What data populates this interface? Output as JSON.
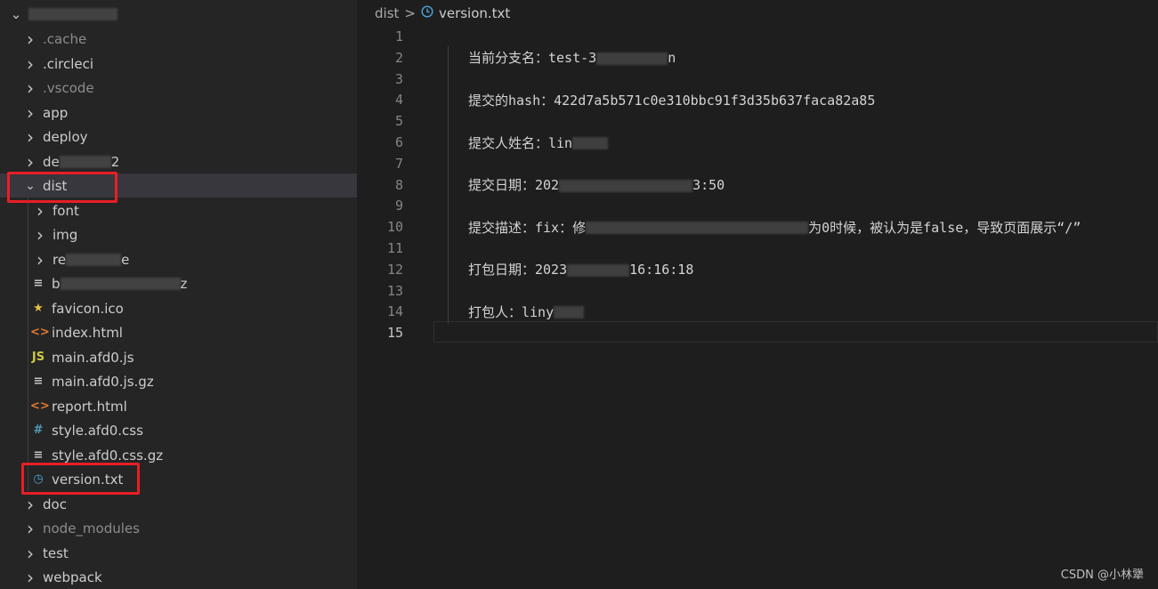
{
  "explorer": {
    "root_label": "",
    "items": [
      {
        "label": ".cache",
        "kind": "folder",
        "expanded": false,
        "dim": true,
        "icon": "chevron-right-icon"
      },
      {
        "label": ".circleci",
        "kind": "folder",
        "expanded": false,
        "dim": false,
        "icon": "chevron-right-icon"
      },
      {
        "label": ".vscode",
        "kind": "folder",
        "expanded": false,
        "dim": true,
        "icon": "chevron-right-icon"
      },
      {
        "label": "app",
        "kind": "folder",
        "expanded": false,
        "dim": false,
        "icon": "chevron-right-icon"
      },
      {
        "label": "deploy",
        "kind": "folder",
        "expanded": false,
        "dim": false,
        "icon": "chevron-right-icon"
      },
      {
        "label": "de",
        "kind": "folder",
        "expanded": false,
        "dim": false,
        "icon": "chevron-right-icon"
      },
      {
        "label": "dist",
        "kind": "folder",
        "expanded": true,
        "dim": false,
        "icon": "chevron-down-icon"
      },
      {
        "label": "font",
        "kind": "folder",
        "expanded": false,
        "dim": false,
        "icon": "chevron-right-icon"
      },
      {
        "label": "img",
        "kind": "folder",
        "expanded": false,
        "dim": false,
        "icon": "chevron-right-icon"
      },
      {
        "label": "re",
        "kind": "folder",
        "expanded": false,
        "dim": false,
        "icon": "chevron-right-icon"
      },
      {
        "label": "b",
        "kind": "file",
        "dim": false,
        "icon": "text-file-icon"
      },
      {
        "label": "favicon.ico",
        "kind": "file",
        "dim": false,
        "icon": "star-icon"
      },
      {
        "label": "index.html",
        "kind": "file",
        "dim": false,
        "icon": "html-icon"
      },
      {
        "label": "main.afd0.js",
        "kind": "file",
        "dim": false,
        "icon": "js-icon"
      },
      {
        "label": "main.afd0.js.gz",
        "kind": "file",
        "dim": false,
        "icon": "text-file-icon"
      },
      {
        "label": "report.html",
        "kind": "file",
        "dim": false,
        "icon": "html-icon"
      },
      {
        "label": "style.afd0.css",
        "kind": "file",
        "dim": false,
        "icon": "css-icon"
      },
      {
        "label": "style.afd0.css.gz",
        "kind": "file",
        "dim": false,
        "icon": "text-file-icon"
      },
      {
        "label": "version.txt",
        "kind": "file",
        "dim": false,
        "icon": "clock-icon"
      },
      {
        "label": "doc",
        "kind": "folder",
        "expanded": false,
        "dim": false,
        "icon": "chevron-right-icon"
      },
      {
        "label": "node_modules",
        "kind": "folder",
        "expanded": false,
        "dim": true,
        "icon": "chevron-right-icon"
      },
      {
        "label": "test",
        "kind": "folder",
        "expanded": false,
        "dim": false,
        "icon": "chevron-right-icon"
      },
      {
        "label": "webpack",
        "kind": "folder",
        "expanded": false,
        "dim": false,
        "icon": "chevron-right-icon"
      }
    ]
  },
  "breadcrumb": {
    "folder": "dist",
    "separator": ">",
    "file": "version.txt"
  },
  "editor": {
    "active_line": 15,
    "lines": [
      {
        "num": "1",
        "text": ""
      },
      {
        "num": "2",
        "text": "当前分支名：test-3",
        "tail": "n"
      },
      {
        "num": "3",
        "text": ""
      },
      {
        "num": "4",
        "text": "提交的hash：422d7a5b571c0e310bbc91f3d35b637faca82a85",
        "tail": ""
      },
      {
        "num": "5",
        "text": ""
      },
      {
        "num": "6",
        "text": "提交人姓名：lin",
        "tail": ""
      },
      {
        "num": "7",
        "text": ""
      },
      {
        "num": "8",
        "text": "提交日期：202",
        "tail": "3:50"
      },
      {
        "num": "9",
        "text": ""
      },
      {
        "num": "10",
        "text": "提交描述：fix：修",
        "tail": "为0时候，被认为是false，导致页面展示“/”"
      },
      {
        "num": "11",
        "text": ""
      },
      {
        "num": "12",
        "text": "打包日期：2023",
        "tail": "16:16:18"
      },
      {
        "num": "13",
        "text": ""
      },
      {
        "num": "14",
        "text": "打包人：liny",
        "tail": ""
      },
      {
        "num": "15",
        "text": ""
      }
    ]
  },
  "watermark": "CSDN @小林犟",
  "colors": {
    "highlight_box": "#e81e25",
    "background": "#1e1e1e",
    "sidebar": "#252526"
  }
}
